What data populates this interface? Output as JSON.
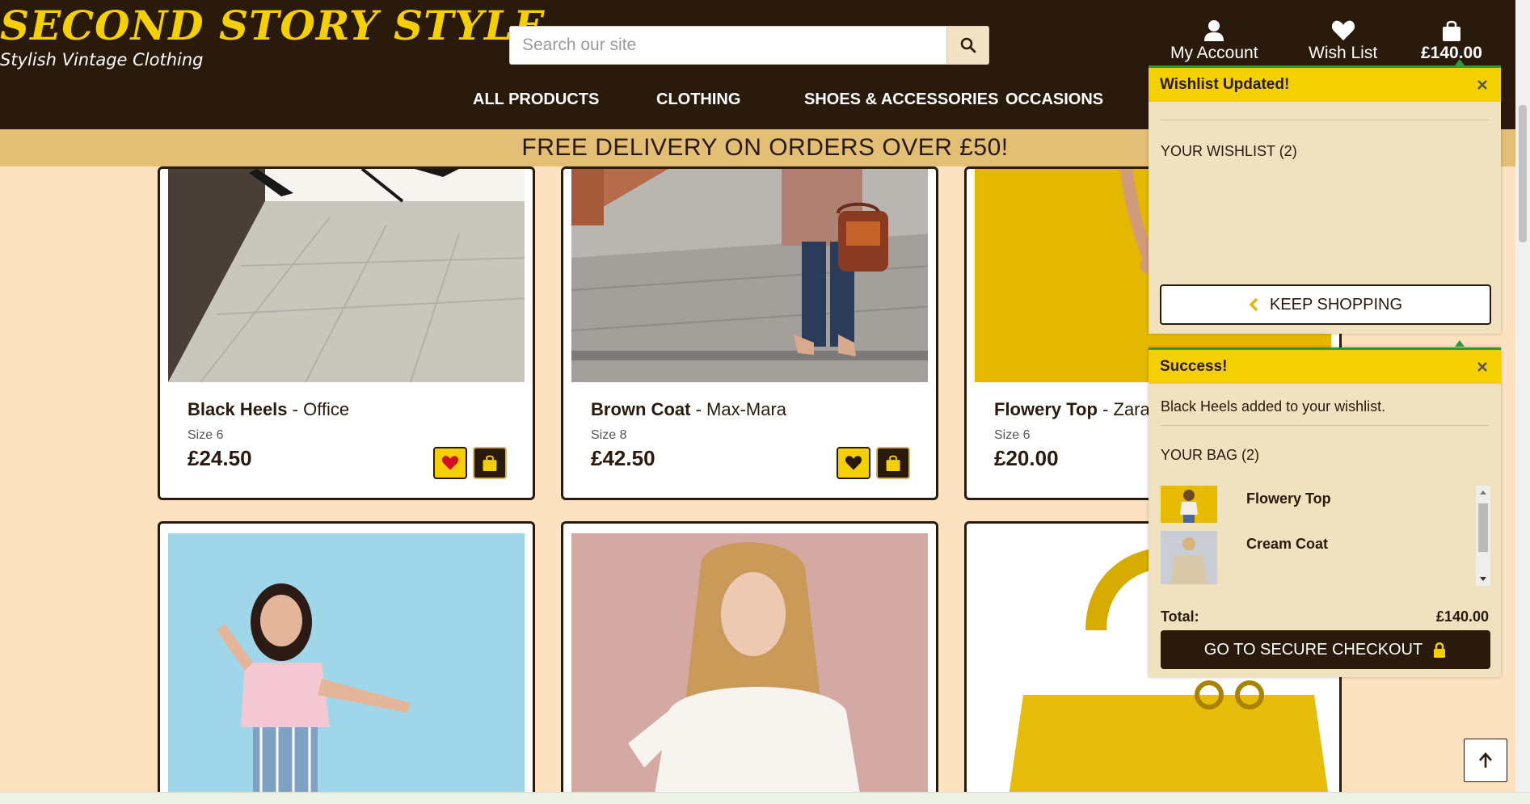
{
  "colors": {
    "brand_dark": "#2a1a0c",
    "brand_yellow": "#f5d000",
    "background": "#fce2c0",
    "banner": "#e2bf75",
    "popup_bg": "#f0e1bf",
    "success_bar": "#2e9a36"
  },
  "header": {
    "logo_title": "SECOND STORY STYLE",
    "logo_subtitle": "Stylish Vintage Clothing",
    "search_placeholder": "Search our site",
    "account_label": "My Account",
    "wishlist_label": "Wish List",
    "bag_total": "£140.00",
    "icons": {
      "search": "search-icon",
      "account": "user-icon",
      "wishlist": "heart-icon",
      "bag": "shopping-bag-icon"
    }
  },
  "nav": {
    "items": [
      "ALL PRODUCTS",
      "CLOTHING",
      "SHOES & ACCESSORIES",
      "OCCASIONS"
    ]
  },
  "banner": {
    "text": "FREE DELIVERY ON ORDERS OVER £50!"
  },
  "products": [
    {
      "name": "Black Heels",
      "brand": "- Office",
      "size": "Size 6",
      "price": "£24.50",
      "wishlisted": true
    },
    {
      "name": "Brown Coat",
      "brand": "- Max-Mara",
      "size": "Size 8",
      "price": "£42.50",
      "wishlisted": false
    },
    {
      "name": "Flowery Top",
      "brand": "- Zara",
      "size": "Size 6",
      "price": "£20.00",
      "wishlisted": false
    }
  ],
  "wishlist_popup": {
    "title": "Wishlist Updated!",
    "section": "YOUR WISHLIST (2)",
    "keep_shopping": "KEEP SHOPPING"
  },
  "success_popup": {
    "title": "Success!",
    "message": "Black Heels added to your wishlist.",
    "section": "YOUR BAG (2)",
    "items": [
      {
        "name": "Flowery Top"
      },
      {
        "name": "Cream Coat"
      }
    ],
    "total_label": "Total:",
    "total_value": "£140.00",
    "checkout": "GO TO SECURE CHECKOUT"
  }
}
